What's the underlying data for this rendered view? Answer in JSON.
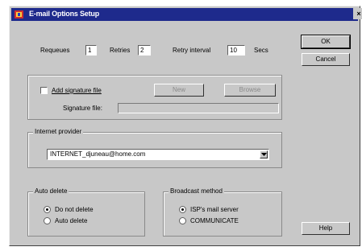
{
  "window": {
    "title": "E-mail Options Setup",
    "close_glyph": "×",
    "title_icon": "app-icon"
  },
  "counters": {
    "requeues_label": "Requeues",
    "requeues_value": "1",
    "retries_label": "Retries",
    "retries_value": "2",
    "retry_interval_label": "Retry interval",
    "retry_interval_value": "10",
    "retry_interval_unit": "Secs"
  },
  "buttons": {
    "ok": "OK",
    "cancel": "Cancel",
    "help": "Help"
  },
  "signature": {
    "add_label": "Add signature file",
    "add_checked": false,
    "new_label": "New",
    "browse_label": "Browse",
    "file_label": "Signature file:",
    "file_value": ""
  },
  "provider": {
    "legend": "Internet provider",
    "selected": "INTERNET_djuneau@home.com"
  },
  "auto_delete": {
    "legend": "Auto delete",
    "options": [
      {
        "label": "Do not delete",
        "selected": true
      },
      {
        "label": "Auto delete",
        "selected": false
      }
    ]
  },
  "broadcast": {
    "legend": "Broadcast method",
    "options": [
      {
        "label": "ISP's mail server",
        "selected": true
      },
      {
        "label": "COMMUNICATE",
        "selected": false
      }
    ]
  },
  "colors": {
    "titlebar": "#1e2a8c",
    "face": "#c8c8c8",
    "field": "#ffffff"
  }
}
